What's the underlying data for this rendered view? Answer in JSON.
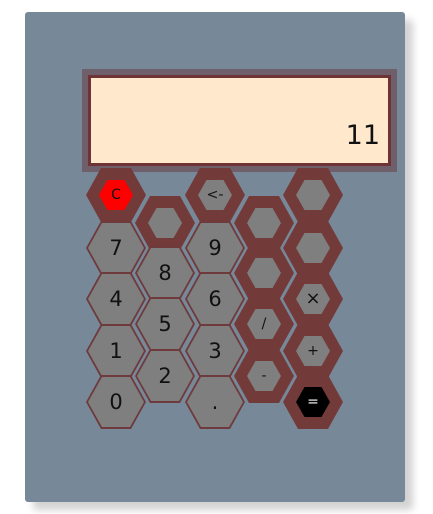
{
  "display": {
    "value": "11"
  },
  "keys": {
    "clear": "C",
    "back": "<-",
    "d7": "7",
    "d8": "8",
    "d9": "9",
    "d4": "4",
    "d5": "5",
    "d6": "6",
    "d1": "1",
    "d2": "2",
    "d3": "3",
    "d0": "0",
    "dot": ".",
    "divide": "/",
    "minus": "-",
    "multiply": "×",
    "plus": "+",
    "equals": "="
  },
  "colors": {
    "body": "#778899",
    "display_bg": "#ffe8cc",
    "key_border": "#733a3a",
    "key_fill": "#7f7f7f",
    "clear_fill": "#ff0000",
    "equals_fill": "#000000"
  }
}
